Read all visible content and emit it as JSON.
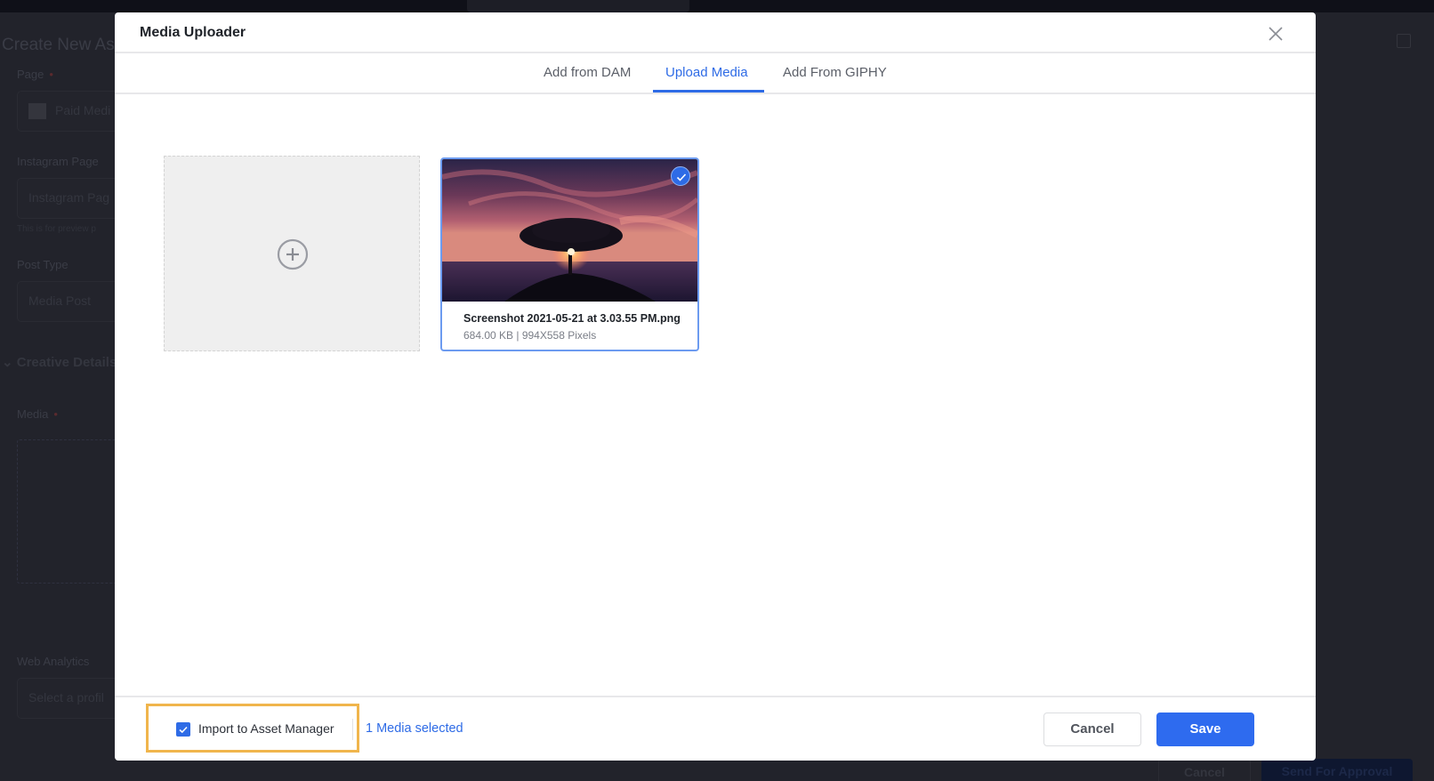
{
  "background_page": {
    "title": "Create New Ass",
    "fields": [
      {
        "label": "Page",
        "required": true,
        "value": "Paid Medi"
      },
      {
        "label": "Instagram Page",
        "required": false,
        "placeholder": "Instagram Pag",
        "hint": "This is for preview p"
      },
      {
        "label": "Post Type",
        "required": false,
        "value": "Media Post"
      },
      {
        "label": "Media",
        "required": true
      },
      {
        "label": "Web Analytics",
        "required": false,
        "placeholder": "Select a profil"
      }
    ],
    "section": "Creative Details",
    "footer": {
      "cancel_label": "Cancel",
      "send_label": "Send For Approval"
    },
    "required_marker": "•"
  },
  "modal": {
    "title": "Media Uploader",
    "close_icon": "close-icon",
    "tabs": [
      {
        "label": "Add from DAM",
        "active": false
      },
      {
        "label": "Upload Media",
        "active": true
      },
      {
        "label": "Add From GIPHY",
        "active": false
      }
    ],
    "dropzone": {
      "icon": "plus-circle-icon"
    },
    "media_items": [
      {
        "name": "Screenshot 2021-05-21 at 3.03.55 PM.png",
        "size": "684.00 KB",
        "dimensions": "994X558 Pixels",
        "meta": "684.00 KB | 994X558 Pixels",
        "selected": true
      }
    ],
    "footer": {
      "import_checkbox_label": "Import to Asset Manager",
      "import_checked": true,
      "media_selected_text": "1 Media selected",
      "cancel_label": "Cancel",
      "save_label": "Save"
    }
  },
  "colors": {
    "accent": "#2e6be6",
    "highlight": "#f0b54c",
    "overlay": "#22232b"
  }
}
